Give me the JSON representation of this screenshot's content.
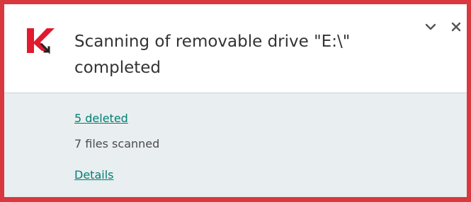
{
  "notification": {
    "title": "Scanning of removable drive \"E:\\\"\ncompleted",
    "deleted_link": "5 deleted",
    "files_scanned": "7 files scanned",
    "details_link": "Details",
    "icons": {
      "logo": "kaspersky-logo-icon",
      "collapse": "chevron-down-icon",
      "close": "close-icon"
    },
    "colors": {
      "frame": "#d9383e",
      "link": "#007f73",
      "logo_red": "#e3192d",
      "panel": "#e9eef0"
    }
  }
}
